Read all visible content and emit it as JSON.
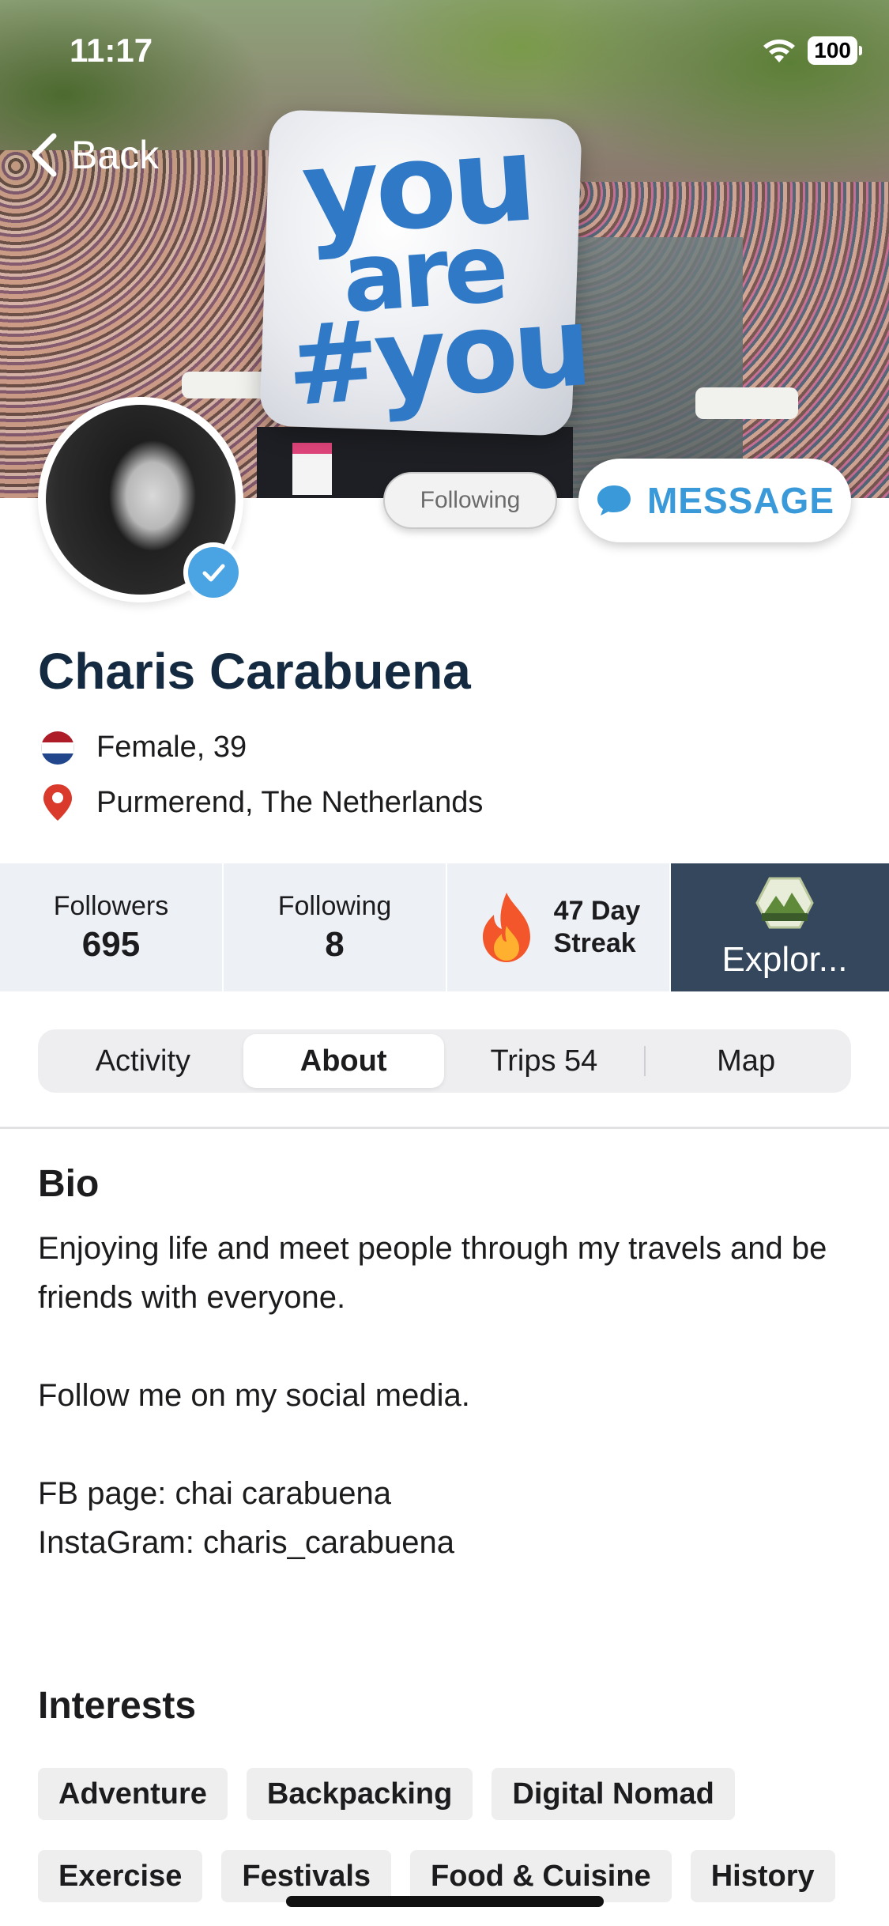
{
  "status_bar": {
    "time": "11:17",
    "battery": "100"
  },
  "nav": {
    "back_label": "Back"
  },
  "banner": {
    "balloon_text": [
      "you",
      "are",
      "#you"
    ]
  },
  "actions": {
    "following_label": "Following",
    "message_label": "MESSAGE"
  },
  "profile": {
    "name": "Charis Carabuena",
    "gender_age": "Female, 39",
    "location": "Purmerend, The Netherlands"
  },
  "stats": {
    "followers_label": "Followers",
    "followers_value": "695",
    "following_label": "Following",
    "following_value": "8",
    "streak_line1": "47 Day",
    "streak_line2": "Streak",
    "explorer_label": "Explor..."
  },
  "tabs": [
    {
      "label": "Activity",
      "active": false
    },
    {
      "label": "About",
      "active": true
    },
    {
      "label": "Trips 54",
      "active": false
    },
    {
      "label": "Map",
      "active": false
    }
  ],
  "bio": {
    "title": "Bio",
    "text": "Enjoying life and meet people through my travels and be friends with everyone.\n\nFollow me on my social media.\n\nFB page: chai carabuena\nInstaGram: charis_carabuena"
  },
  "interests": {
    "title": "Interests",
    "row1": [
      "Adventure",
      "Backpacking",
      "Digital Nomad"
    ],
    "row2": [
      "Exercise",
      "Festivals",
      "Food & Cuisine",
      "History"
    ]
  },
  "colors": {
    "accent": "#3a9ad9",
    "name_color": "#142a40",
    "stats_bg": "#edf1f6",
    "explorer_bg": "#34475c",
    "verified_badge": "#4aa3e3"
  },
  "icons": [
    "back-chevron-icon",
    "wifi-icon",
    "battery-icon",
    "verified-check-icon",
    "chat-bubble-icon",
    "netherlands-flag-icon",
    "location-pin-icon",
    "fire-icon",
    "explorer-badge-icon"
  ]
}
